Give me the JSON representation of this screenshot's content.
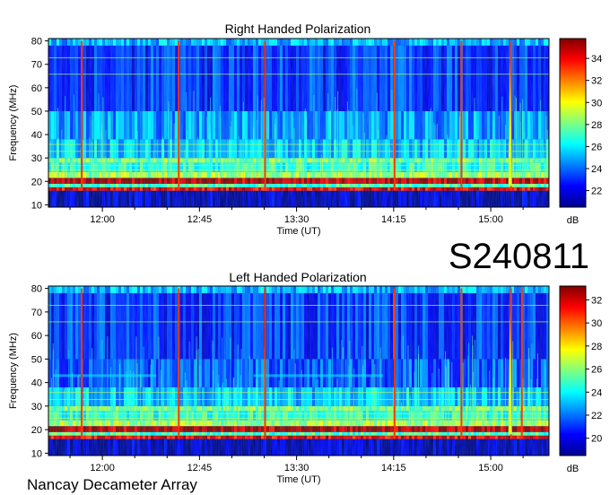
{
  "event_id": "S240811",
  "footer": "Nancay Decameter Array",
  "colorbar_unit": "dB",
  "chart_data": [
    {
      "type": "heatmap",
      "title": "Right Handed Polarization",
      "xlabel": "Time (UT)",
      "ylabel": "Frequency (MHz)",
      "x_ticks": [
        "12:00",
        "12:45",
        "13:30",
        "14:15",
        "15:00"
      ],
      "x_tick_minutes": [
        720,
        765,
        810,
        855,
        900
      ],
      "x_range_minutes": [
        695,
        927
      ],
      "y_ticks": [
        10,
        20,
        30,
        40,
        50,
        60,
        70,
        80
      ],
      "ylim": [
        9,
        81
      ],
      "colorbar": {
        "ticks": [
          22,
          24,
          26,
          28,
          30,
          32,
          34
        ],
        "range": [
          20.5,
          35.8
        ],
        "unit": "dB"
      },
      "bursts_minutes": [
        710,
        755,
        795,
        855,
        886,
        909
      ],
      "strong_burst_minutes": 909
    },
    {
      "type": "heatmap",
      "title": "Left Handed Polarization",
      "xlabel": "Time (UT)",
      "ylabel": "Frequency (MHz)",
      "x_ticks": [
        "12:00",
        "12:45",
        "13:30",
        "14:15",
        "15:00"
      ],
      "x_tick_minutes": [
        720,
        765,
        810,
        855,
        900
      ],
      "x_range_minutes": [
        695,
        927
      ],
      "y_ticks": [
        10,
        20,
        30,
        40,
        50,
        60,
        70,
        80
      ],
      "ylim": [
        9,
        81
      ],
      "colorbar": {
        "ticks": [
          20,
          22,
          24,
          26,
          28,
          30,
          32
        ],
        "range": [
          18.5,
          33.2
        ],
        "unit": "dB"
      },
      "bursts_minutes": [
        710,
        755,
        795,
        855,
        886,
        909,
        914
      ],
      "strong_burst_minutes": 909
    }
  ]
}
